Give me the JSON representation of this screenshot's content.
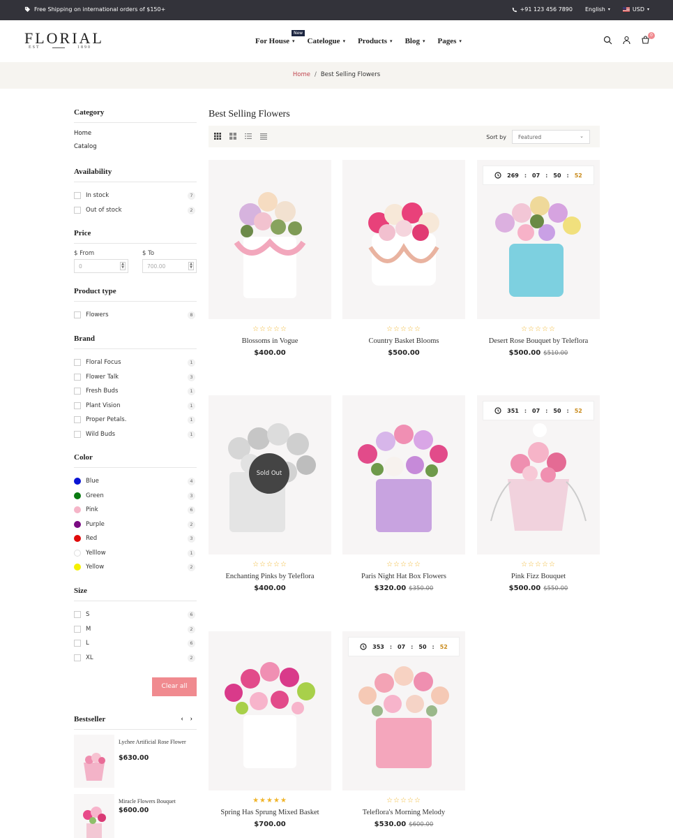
{
  "topbar": {
    "shipping": "Free Shipping on international orders of $150+",
    "phone": "+91 123 456 7890",
    "language": "English",
    "currency": "USD"
  },
  "header": {
    "logo": {
      "name": "FLORIAL",
      "est_left": "EST",
      "est_right": "1890"
    },
    "nav": [
      {
        "label": "For House",
        "badge": "New"
      },
      {
        "label": "Catelogue"
      },
      {
        "label": "Products"
      },
      {
        "label": "Blog"
      },
      {
        "label": "Pages"
      }
    ],
    "cart_count": "0"
  },
  "breadcrumb": {
    "home": "Home",
    "separator": "/",
    "current": "Best Selling Flowers"
  },
  "sidebar": {
    "category": {
      "title": "Category",
      "links": [
        "Home",
        "Catalog"
      ]
    },
    "availability": {
      "title": "Availability",
      "items": [
        {
          "label": "In stock",
          "count": "7"
        },
        {
          "label": "Out of stock",
          "count": "2"
        }
      ]
    },
    "price": {
      "title": "Price",
      "from_label": "$ From",
      "to_label": "$ To",
      "from_placeholder": "0",
      "to_placeholder": "700.00"
    },
    "product_type": {
      "title": "Product type",
      "items": [
        {
          "label": "Flowers",
          "count": "8"
        }
      ]
    },
    "brand": {
      "title": "Brand",
      "items": [
        {
          "label": "Floral Focus",
          "count": "1"
        },
        {
          "label": "Flower Talk",
          "count": "3"
        },
        {
          "label": "Fresh Buds",
          "count": "1"
        },
        {
          "label": "Plant Vision",
          "count": "1"
        },
        {
          "label": "Proper Petals.",
          "count": "1"
        },
        {
          "label": "Wild Buds",
          "count": "1"
        }
      ]
    },
    "color": {
      "title": "Color",
      "items": [
        {
          "label": "Blue",
          "count": "4",
          "swatch": "#0a14d4"
        },
        {
          "label": "Green",
          "count": "3",
          "swatch": "#0a7a12"
        },
        {
          "label": "Pink",
          "count": "6",
          "swatch": "#f5b5c8"
        },
        {
          "label": "Purple",
          "count": "2",
          "swatch": "#7a0a82"
        },
        {
          "label": "Red",
          "count": "3",
          "swatch": "#e00a0a"
        },
        {
          "label": "Yelllow",
          "count": "1",
          "swatch": "#ffffff"
        },
        {
          "label": "Yellow",
          "count": "2",
          "swatch": "#f5f000"
        }
      ]
    },
    "size": {
      "title": "Size",
      "items": [
        {
          "label": "S",
          "count": "6"
        },
        {
          "label": "M",
          "count": "2"
        },
        {
          "label": "L",
          "count": "6"
        },
        {
          "label": "XL",
          "count": "2"
        }
      ]
    },
    "clear_all": "Clear all",
    "bestseller": {
      "title": "Bestseller",
      "items": [
        {
          "name": "Lychee Artificial Rose Flower",
          "price": "$630.00"
        },
        {
          "name": "Miracle Flowers Bouquet",
          "price": "$600.00"
        }
      ]
    }
  },
  "main": {
    "title": "Best Selling Flowers",
    "sort_label": "Sort by",
    "sort_value": "Featured",
    "products": [
      {
        "name": "Blossoms in Vogue",
        "price": "$400.00",
        "old_price": "",
        "stars": "☆☆☆☆☆",
        "color": "#f2b7c4"
      },
      {
        "name": "Country Basket Blooms",
        "price": "$500.00",
        "old_price": "",
        "stars": "☆☆☆☆☆",
        "color": "#e8417a"
      },
      {
        "name": "Desert Rose Bouquet by Teleflora",
        "price": "$500.00",
        "old_price": "$510.00",
        "stars": "☆☆☆☆☆",
        "color": "#d9a6d9",
        "timer": [
          "269",
          "07",
          "50",
          "52"
        ]
      },
      {
        "name": "Enchanting Pinks by Teleflora",
        "price": "$400.00",
        "old_price": "",
        "stars": "☆☆☆☆☆",
        "color": "#cfcfcf",
        "sold_out": "Sold Out"
      },
      {
        "name": "Paris Night Hat Box Flowers",
        "price": "$320.00",
        "old_price": "$350.00",
        "stars": "☆☆☆☆☆",
        "color": "#e24b8a"
      },
      {
        "name": "Pink Fizz Bouquet",
        "price": "$500.00",
        "old_price": "$550.00",
        "stars": "☆☆☆☆☆",
        "color": "#ef8fb0",
        "timer": [
          "351",
          "07",
          "50",
          "52"
        ]
      },
      {
        "name": "Spring Has Sprung Mixed Basket",
        "price": "$700.00",
        "old_price": "",
        "stars": "★★★★★",
        "color": "#d93a8a"
      },
      {
        "name": "Teleflora's Morning Melody",
        "price": "$530.00",
        "old_price": "$600.00",
        "stars": "☆☆☆☆☆",
        "color": "#f3a3b5",
        "timer": [
          "353",
          "07",
          "50",
          "52"
        ]
      }
    ]
  }
}
